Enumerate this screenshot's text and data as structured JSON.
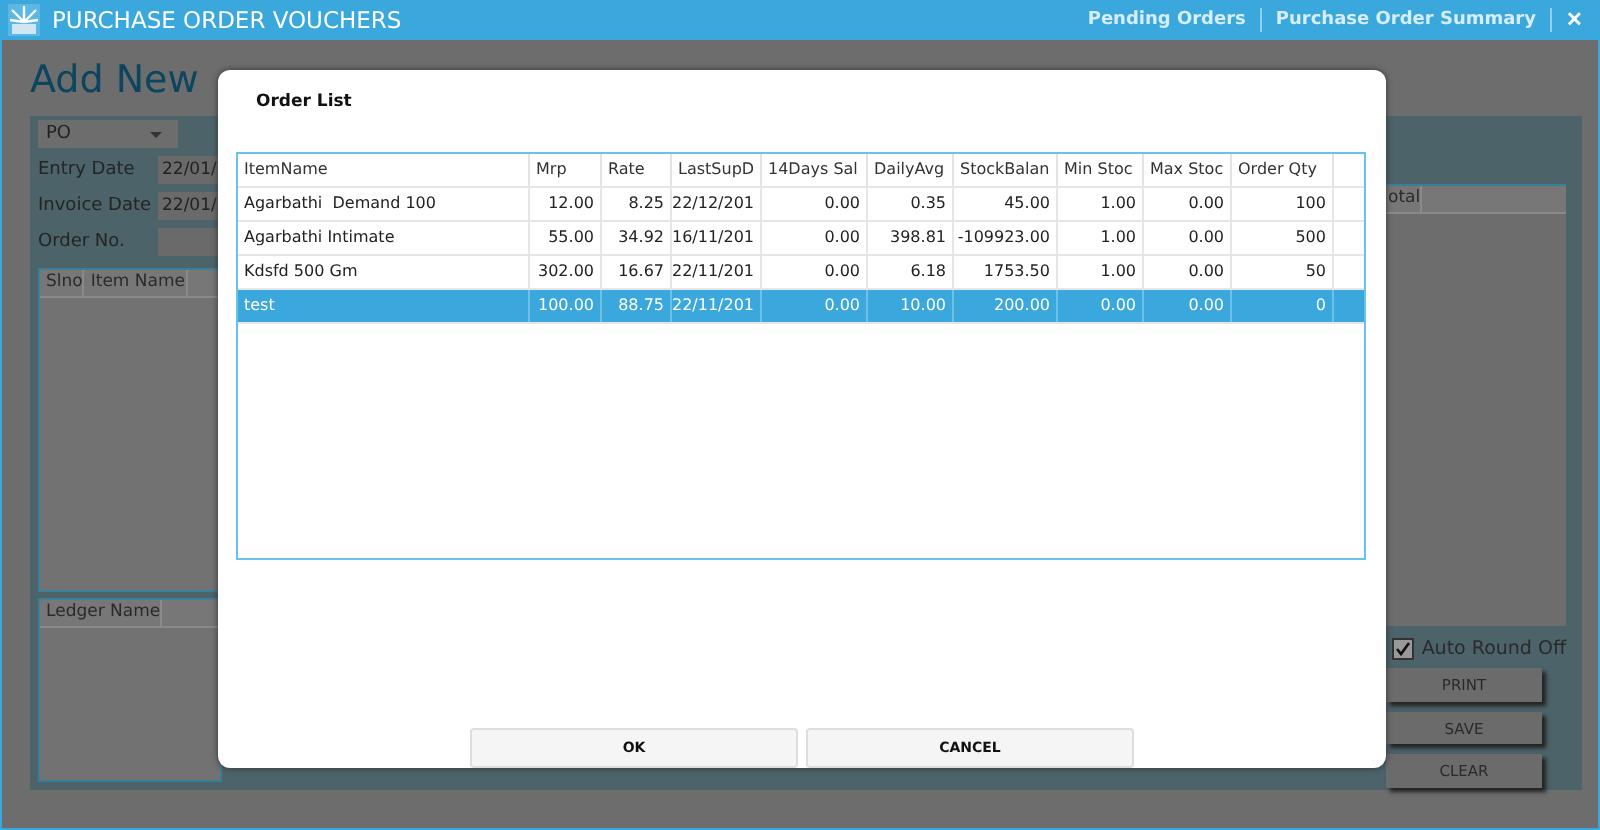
{
  "window": {
    "title": "PURCHASE ORDER VOUCHERS"
  },
  "nav_links": [
    "Pending Orders",
    "Purchase Order Summary"
  ],
  "close_label": "✕",
  "heading": "Add New",
  "voucher_type": "PO",
  "fields": [
    {
      "label": "Entry Date",
      "value": "22/01/"
    },
    {
      "label": "Invoice Date",
      "value": "22/01/"
    },
    {
      "label": "Order No."
    }
  ],
  "items_grid": {
    "columns": [
      "Slno",
      "Item Name"
    ]
  },
  "totals_grid": {
    "columns": [
      "otal"
    ]
  },
  "ledger_grid": {
    "columns": [
      "Ledger Name"
    ]
  },
  "auto_round_off": {
    "label": "Auto Round Off",
    "checked": true
  },
  "actions": [
    "PRINT",
    "SAVE",
    "CLEAR"
  ],
  "dialog": {
    "title": "Order List",
    "columns": [
      "ItemName",
      "Mrp",
      "Rate",
      "LastSupD",
      "14Days Sal",
      "DailyAvg",
      "StockBalan",
      "Min Stoc",
      "Max Stoc",
      "Order Qty"
    ],
    "rows": [
      {
        "cells": [
          "Agarbathi  Demand 100",
          "12.00",
          "8.25",
          "22/12/201",
          "0.00",
          "0.35",
          "45.00",
          "1.00",
          "0.00",
          "100"
        ],
        "selected": false
      },
      {
        "cells": [
          "Agarbathi Intimate",
          "55.00",
          "34.92",
          "16/11/201",
          "0.00",
          "398.81",
          "-109923.00",
          "1.00",
          "0.00",
          "500"
        ],
        "selected": false
      },
      {
        "cells": [
          "Kdsfd 500 Gm",
          "302.00",
          "16.67",
          "22/11/201",
          "0.00",
          "6.18",
          "1753.50",
          "1.00",
          "0.00",
          "50"
        ],
        "selected": false
      },
      {
        "cells": [
          "test",
          "100.00",
          "88.75",
          "22/11/201",
          "0.00",
          "10.00",
          "200.00",
          "0.00",
          "0.00",
          "0"
        ],
        "selected": true
      }
    ],
    "buttons": [
      "OK",
      "CANCEL"
    ]
  }
}
